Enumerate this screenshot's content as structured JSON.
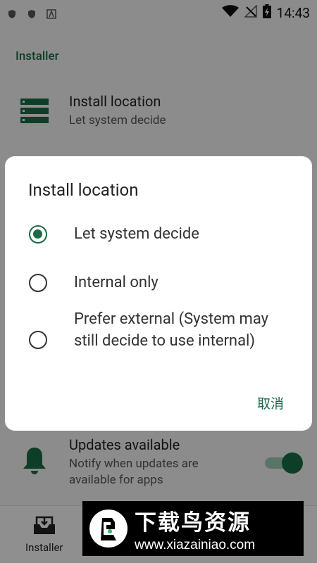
{
  "status_bar": {
    "time": "14:43"
  },
  "section": {
    "title": "Installer"
  },
  "install_location": {
    "title": "Install location",
    "summary": "Let system decide"
  },
  "updates": {
    "title": "Updates available",
    "summary": "Notify when updates are available for apps",
    "enabled": true
  },
  "bottom_nav": {
    "installer_label": "Installer"
  },
  "dialog": {
    "title": "Install location",
    "options": [
      {
        "label": "Let system decide",
        "selected": true
      },
      {
        "label": "Internal only",
        "selected": false
      },
      {
        "label": "Prefer external (System may still decide to use internal)",
        "selected": false
      }
    ],
    "cancel_label": "取消"
  },
  "watermark": {
    "main": "下载鸟资源",
    "url": "www.xiazainiao.com"
  },
  "colors": {
    "accent": "#1b6b46"
  }
}
